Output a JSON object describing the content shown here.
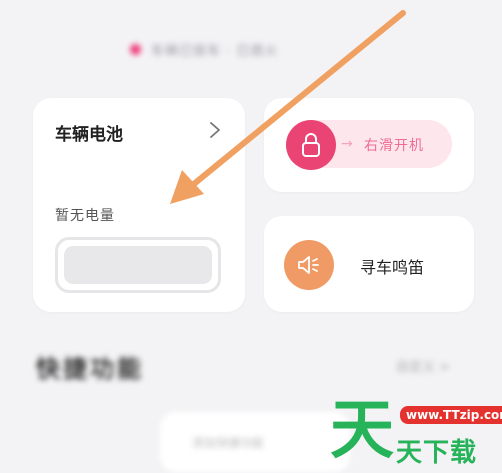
{
  "status": {
    "text": "车辆已锁车 · 已熄火"
  },
  "battery_card": {
    "title": "车辆电池",
    "no_power": "暂无电量"
  },
  "unlock": {
    "label": "右滑开机",
    "arrow": "→"
  },
  "horn": {
    "label": "寻车鸣笛"
  },
  "quick": {
    "title": "快捷功能",
    "custom": "自定义 >"
  },
  "blur_button": {
    "label": "添加快捷功能"
  },
  "watermark": {
    "big": "天",
    "url": "www.TTzip.com",
    "site": "天下载"
  },
  "colors": {
    "accent": "#e94473",
    "horn": "#f09a66",
    "arrow": "#f0a060",
    "watermark_green": "#27b35a",
    "watermark_red": "#e4332e"
  },
  "icons": {
    "chevron": "chevron-right-icon",
    "lock": "lock-icon",
    "horn": "horn-icon"
  }
}
